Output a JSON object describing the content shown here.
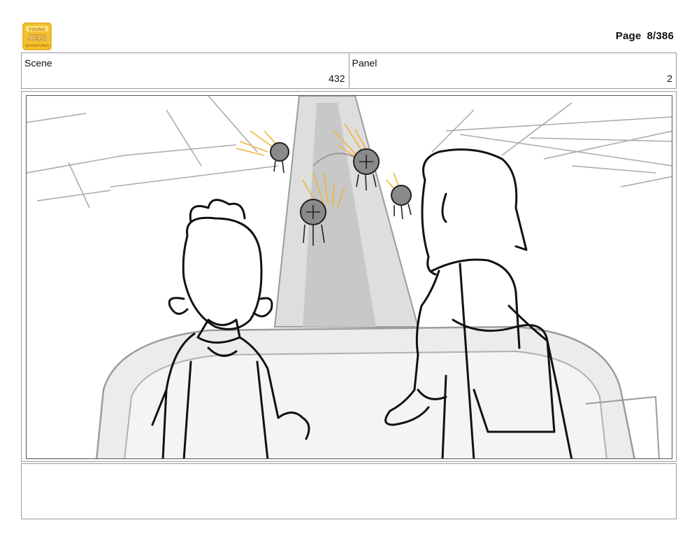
{
  "header": {
    "logo_text": [
      "YOUNG",
      "JEDI",
      "ADVENTURES"
    ],
    "page_label": "Page",
    "page_value": "8/386"
  },
  "info": {
    "scene_label": "Scene",
    "scene_value": "432",
    "panel_label": "Panel",
    "panel_value": "2"
  },
  "colors": {
    "logo_yellow": "#f2c230",
    "logo_orange": "#e8a21a",
    "sketch_black": "#111111",
    "sketch_gray": "#9c9c9c",
    "drone_glow": "#f0b43a"
  }
}
